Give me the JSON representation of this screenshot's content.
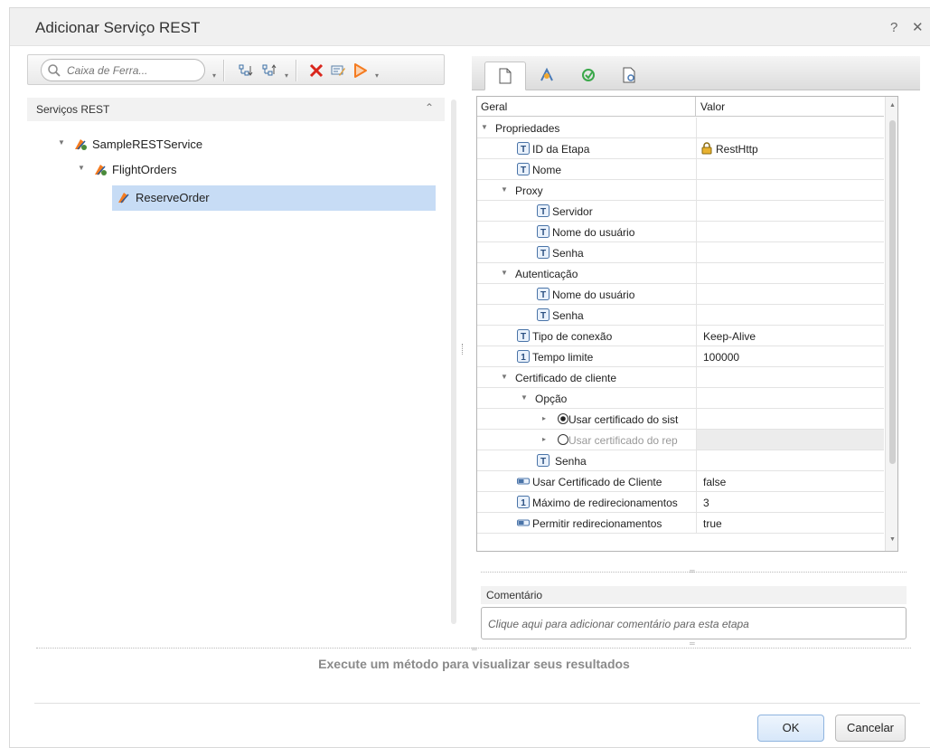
{
  "dialog": {
    "title": "Adicionar Serviço REST",
    "help_label": "?",
    "close_label": "✕"
  },
  "toolbar": {
    "search_placeholder": "Caixa de Ferra..."
  },
  "left_panel": {
    "header": "Serviços REST",
    "tree": [
      {
        "label": "SampleRESTService",
        "level": 0,
        "expanded": true
      },
      {
        "label": "FlightOrders",
        "level": 1,
        "expanded": true
      },
      {
        "label": "ReserveOrder",
        "level": 2,
        "selected": true
      }
    ]
  },
  "grid": {
    "col_general": "Geral",
    "col_value": "Valor",
    "rows": [
      {
        "label": "Propriedades",
        "value": ""
      },
      {
        "label": "ID da Etapa",
        "value": "RestHttp"
      },
      {
        "label": "Nome",
        "value": ""
      },
      {
        "label": "Proxy",
        "value": ""
      },
      {
        "label": "Servidor",
        "value": ""
      },
      {
        "label": "Nome do usuário",
        "value": ""
      },
      {
        "label": "Senha",
        "value": ""
      },
      {
        "label": "Autenticação",
        "value": ""
      },
      {
        "label": "Nome do usuário",
        "value": ""
      },
      {
        "label": "Senha",
        "value": ""
      },
      {
        "label": "Tipo de conexão",
        "value": "Keep-Alive"
      },
      {
        "label": "Tempo limite",
        "value": "100000"
      },
      {
        "label": "Certificado de cliente",
        "value": ""
      },
      {
        "label": "Opção",
        "value": ""
      },
      {
        "label": "Usar certificado do sist",
        "value": ""
      },
      {
        "label": "Usar certificado do rep",
        "value": ""
      },
      {
        "label": "Senha",
        "value": ""
      },
      {
        "label": "Usar Certificado de Cliente",
        "value": "false"
      },
      {
        "label": "Máximo de redirecionamentos",
        "value": "3"
      },
      {
        "label": "Permitir redirecionamentos",
        "value": "true"
      }
    ]
  },
  "comment": {
    "label": "Comentário",
    "placeholder": "Clique aqui para adicionar comentário para esta etapa"
  },
  "results_message": "Execute um método para visualizar seus resultados",
  "buttons": {
    "ok": "OK",
    "cancel": "Cancelar"
  },
  "colors": {
    "selection": "#c7dcf5",
    "delete_icon": "#d9261c",
    "run_icon": "#f47b20"
  }
}
